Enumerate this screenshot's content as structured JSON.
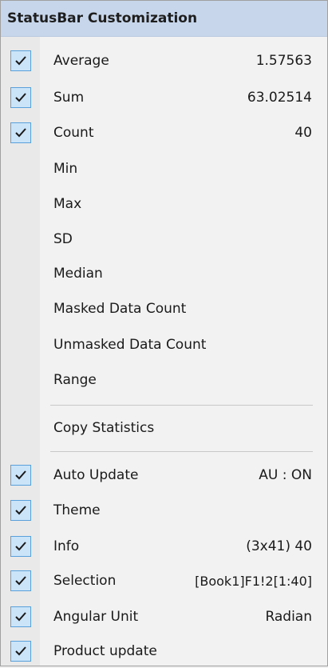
{
  "menu": {
    "title": "StatusBar Customization",
    "colors": {
      "header_bg": "#c7d6ea",
      "check_bg": "#cce4f7",
      "check_border": "#5aa0db",
      "check_mark": "#1a1a1a"
    },
    "stats": [
      {
        "label": "Average",
        "value": "1.57563",
        "checked": true
      },
      {
        "label": "Sum",
        "value": "63.02514",
        "checked": true
      },
      {
        "label": "Count",
        "value": "40",
        "checked": true
      },
      {
        "label": "Min",
        "value": "",
        "checked": false
      },
      {
        "label": "Max",
        "value": "",
        "checked": false
      },
      {
        "label": "SD",
        "value": "",
        "checked": false
      },
      {
        "label": "Median",
        "value": "",
        "checked": false
      },
      {
        "label": "Masked Data Count",
        "value": "",
        "checked": false
      },
      {
        "label": "Unmasked Data Count",
        "value": "",
        "checked": false
      },
      {
        "label": "Range",
        "value": "",
        "checked": false
      }
    ],
    "copy_statistics": "Copy Statistics",
    "options": [
      {
        "label": "Auto Update",
        "value": "AU : ON",
        "checked": true
      },
      {
        "label": "Theme",
        "value": "",
        "checked": true
      },
      {
        "label": "Info",
        "value": "(3x41) 40",
        "checked": true
      },
      {
        "label": "Selection",
        "value": "[Book1]F1!2[1:40]",
        "checked": true
      },
      {
        "label": "Angular Unit",
        "value": "Radian",
        "checked": true
      },
      {
        "label": "Product update",
        "value": "",
        "checked": true
      }
    ]
  }
}
